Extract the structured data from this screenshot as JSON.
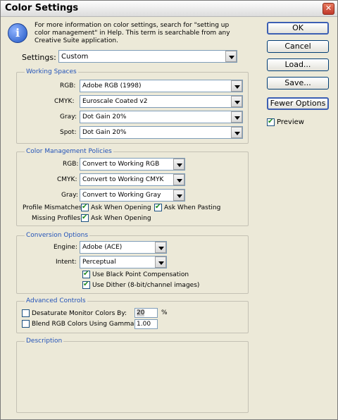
{
  "window": {
    "title": "Color Settings",
    "close_glyph": "✕"
  },
  "info": {
    "icon": "info-icon",
    "text_lines": [
      "For more information on color settings, search for \"setting up",
      "color management\" in Help. This term is searchable from any",
      "Creative Suite application."
    ]
  },
  "buttons": {
    "ok": "OK",
    "cancel": "Cancel",
    "load": "Load...",
    "save": "Save...",
    "fewer_options": "Fewer Options"
  },
  "preview": {
    "label": "Preview",
    "checked": true
  },
  "settings": {
    "label": "Settings:",
    "value": "Custom"
  },
  "working_spaces": {
    "title": "Working Spaces",
    "rgb": {
      "label": "RGB:",
      "value": "Adobe RGB (1998)"
    },
    "cmyk": {
      "label": "CMYK:",
      "value": "Euroscale Coated v2"
    },
    "gray": {
      "label": "Gray:",
      "value": "Dot Gain 20%"
    },
    "spot": {
      "label": "Spot:",
      "value": "Dot Gain 20%"
    }
  },
  "policies": {
    "title": "Color Management Policies",
    "rgb": {
      "label": "RGB:",
      "value": "Convert to Working RGB"
    },
    "cmyk": {
      "label": "CMYK:",
      "value": "Convert to Working CMYK"
    },
    "gray": {
      "label": "Gray:",
      "value": "Convert to Working Gray"
    },
    "profile_mismatches": {
      "label": "Profile Mismatches:",
      "ask_opening": "Ask When Opening",
      "ask_pasting": "Ask When Pasting"
    },
    "missing_profiles": {
      "label": "Missing Profiles:",
      "ask_opening": "Ask When Opening"
    }
  },
  "conversion": {
    "title": "Conversion Options",
    "engine": {
      "label": "Engine:",
      "value": "Adobe (ACE)"
    },
    "intent": {
      "label": "Intent:",
      "value": "Perceptual"
    },
    "black_point": "Use Black Point Compensation",
    "dither": "Use Dither (8-bit/channel images)"
  },
  "advanced": {
    "title": "Advanced Controls",
    "desaturate": {
      "label": "Desaturate Monitor Colors By:",
      "value": "20",
      "unit": "%"
    },
    "blend": {
      "label": "Blend RGB Colors Using Gamma:",
      "value": "1.00"
    }
  },
  "description": {
    "title": "Description"
  }
}
